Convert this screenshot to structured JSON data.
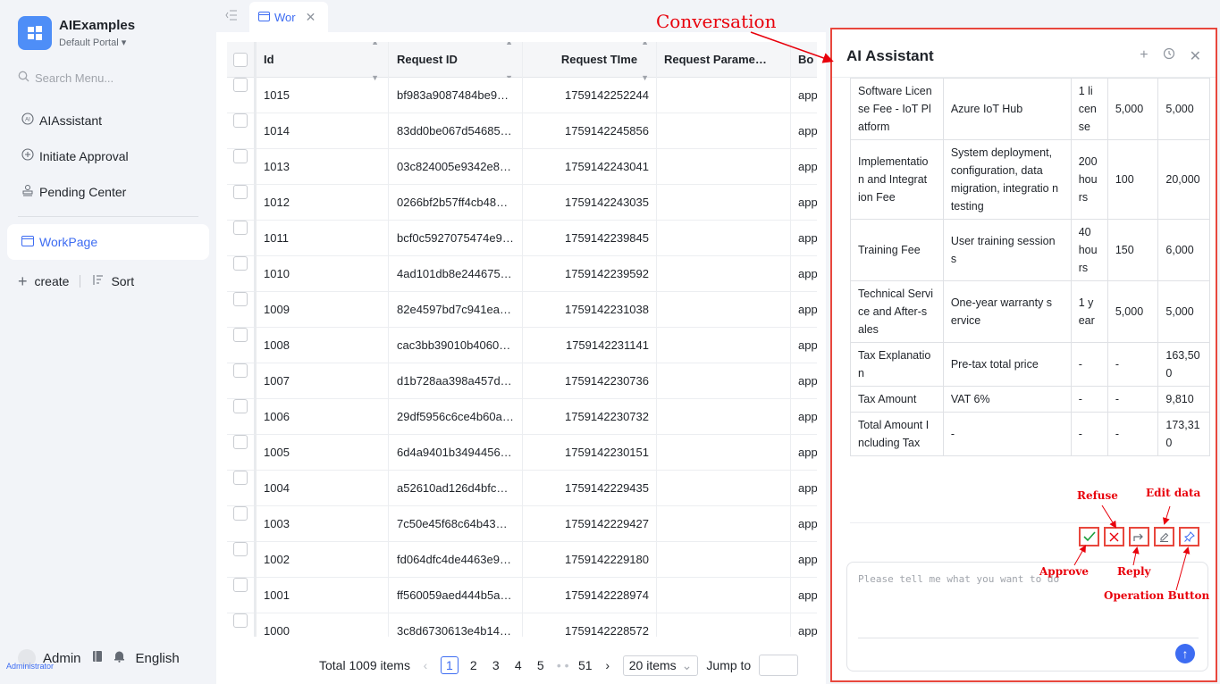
{
  "app": {
    "name": "AIExamples",
    "portal": "Default Portal"
  },
  "sidebar": {
    "search_placeholder": "Search Menu...",
    "items": [
      {
        "label": "AIAssistant"
      },
      {
        "label": "Initiate Approval"
      },
      {
        "label": "Pending Center"
      }
    ],
    "active_item": "WorkPage",
    "create_label": "create",
    "sort_label": "Sort",
    "user": "Admin",
    "role": "Administrator",
    "language": "English"
  },
  "tab": {
    "label": "Wor"
  },
  "table": {
    "headers": {
      "id": "Id",
      "request_id": "Request ID",
      "request_time": "Request TIme",
      "request_param": "Request Parame…",
      "bo": "Bo"
    },
    "rows": [
      {
        "id": "1015",
        "rid": "bf983a9087484be9…",
        "time": "1759142252244",
        "bo": "app"
      },
      {
        "id": "1014",
        "rid": "83dd0be067d54685…",
        "time": "1759142245856",
        "bo": "app"
      },
      {
        "id": "1013",
        "rid": "03c824005e9342e8…",
        "time": "1759142243041",
        "bo": "app"
      },
      {
        "id": "1012",
        "rid": "0266bf2b57ff4cb48…",
        "time": "1759142243035",
        "bo": "app"
      },
      {
        "id": "1011",
        "rid": "bcf0c5927075474e9…",
        "time": "1759142239845",
        "bo": "app"
      },
      {
        "id": "1010",
        "rid": "4ad101db8e244675…",
        "time": "1759142239592",
        "bo": "app"
      },
      {
        "id": "1009",
        "rid": "82e4597bd7c941ea…",
        "time": "1759142231038",
        "bo": "app"
      },
      {
        "id": "1008",
        "rid": "cac3bb39010b4060…",
        "time": "1759142231141",
        "bo": "app"
      },
      {
        "id": "1007",
        "rid": "d1b728aa398a457d…",
        "time": "1759142230736",
        "bo": "app"
      },
      {
        "id": "1006",
        "rid": "29df5956c6ce4b60a…",
        "time": "1759142230732",
        "bo": "app"
      },
      {
        "id": "1005",
        "rid": "6d4a9401b3494456…",
        "time": "1759142230151",
        "bo": "app"
      },
      {
        "id": "1004",
        "rid": "a52610ad126d4bfc…",
        "time": "1759142229435",
        "bo": "app"
      },
      {
        "id": "1003",
        "rid": "7c50e45f68c64b43…",
        "time": "1759142229427",
        "bo": "app"
      },
      {
        "id": "1002",
        "rid": "fd064dfc4de4463e9…",
        "time": "1759142229180",
        "bo": "app"
      },
      {
        "id": "1001",
        "rid": "ff560059aed444b5a…",
        "time": "1759142228974",
        "bo": "app"
      },
      {
        "id": "1000",
        "rid": "3c8d6730613e4b14…",
        "time": "1759142228572",
        "bo": "app"
      }
    ]
  },
  "pagination": {
    "total": "Total 1009 items",
    "pages": [
      "1",
      "2",
      "3",
      "4",
      "5"
    ],
    "last_page": "51",
    "page_size": "20 items",
    "jump_label": "Jump to"
  },
  "ai_panel": {
    "title": "AI Assistant",
    "quote_rows": [
      [
        "Software Licen se Fee - IoT Pl atform",
        "Azure IoT Hub",
        "1 li cen se",
        "5,000",
        "5,000"
      ],
      [
        "Implementatio n and Integrat ion Fee",
        "System deployment, configuration, data migration, integratio n testing",
        "200 hou rs",
        "100",
        "20,000"
      ],
      [
        "Training Fee",
        "User training session s",
        "40 hou rs",
        "150",
        "6,000"
      ],
      [
        "Technical Servi ce and After-s ales",
        "One-year warranty s ervice",
        "1 y ear",
        "5,000",
        "5,000"
      ],
      [
        "Tax Explanatio n",
        "Pre-tax total price",
        "-",
        "-",
        "163,50 0"
      ],
      [
        "Tax Amount",
        "VAT 6%",
        "-",
        "-",
        "9,810"
      ],
      [
        "Total Amount I ncluding Tax",
        "-",
        "-",
        "-",
        "173,31 0"
      ]
    ],
    "input_placeholder": "Please tell me what you want to do"
  },
  "annotations": {
    "conversation": "Conversation",
    "refuse": "Refuse",
    "edit_data": "Edit data",
    "approve": "Approve",
    "reply": "Reply",
    "operation_button": "Operation Button"
  },
  "colors": {
    "accent": "#3d6cf2",
    "annotation": "#e8000b",
    "approve": "#1a9e3a"
  }
}
